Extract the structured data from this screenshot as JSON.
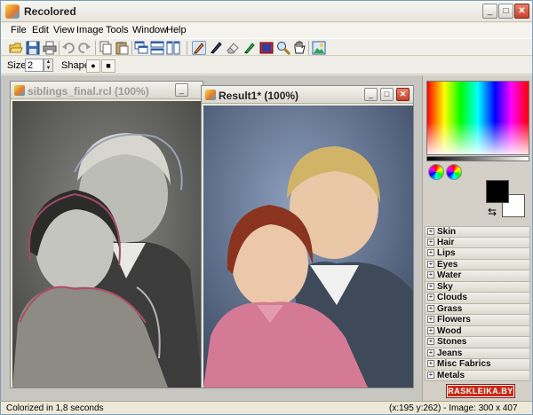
{
  "window": {
    "title": "Recolored",
    "minimize": "_",
    "maximize": "□",
    "close": "✕"
  },
  "menu": {
    "items": [
      {
        "label": "File"
      },
      {
        "label": "Edit"
      },
      {
        "label": "View"
      },
      {
        "label": "Image"
      },
      {
        "label": "Tools"
      },
      {
        "label": "Window"
      },
      {
        "label": "Help"
      }
    ]
  },
  "toolbar": {
    "icons": [
      "open-icon",
      "save-icon",
      "print-icon",
      "undo-icon",
      "redo-icon",
      "copy-icon",
      "paste-icon",
      "cascade-icon",
      "tile-horizontal-icon",
      "tile-vertical-icon",
      "pen-icon",
      "brush-icon",
      "eraser-icon",
      "fill-icon",
      "color-picker-icon",
      "zoom-icon",
      "hand-icon",
      "image-icon"
    ]
  },
  "options": {
    "size_label": "Size",
    "size_value": "2",
    "spin_up": "▲",
    "spin_down": "▼",
    "shape_label": "Shape",
    "shape_round": "●",
    "shape_square": "■"
  },
  "documents": {
    "source": {
      "title": "siblings_final.rcl (100%)"
    },
    "result": {
      "title": "Result1* (100%)"
    }
  },
  "colors": {
    "foreground": "#000000",
    "background": "#ffffff",
    "swap": "⇆"
  },
  "categories": [
    {
      "label": "Skin"
    },
    {
      "label": "Hair"
    },
    {
      "label": "Lips"
    },
    {
      "label": "Eyes"
    },
    {
      "label": "Water"
    },
    {
      "label": "Sky"
    },
    {
      "label": "Clouds"
    },
    {
      "label": "Grass"
    },
    {
      "label": "Flowers"
    },
    {
      "label": "Wood"
    },
    {
      "label": "Stones"
    },
    {
      "label": "Jeans"
    },
    {
      "label": "Misc Fabrics"
    },
    {
      "label": "Metals"
    }
  ],
  "status": {
    "left": "Colorized in 1,8 seconds",
    "right": "(x:195 y:262) - Image: 300 x 407"
  },
  "watermark": "RASKLEIKA.BY"
}
